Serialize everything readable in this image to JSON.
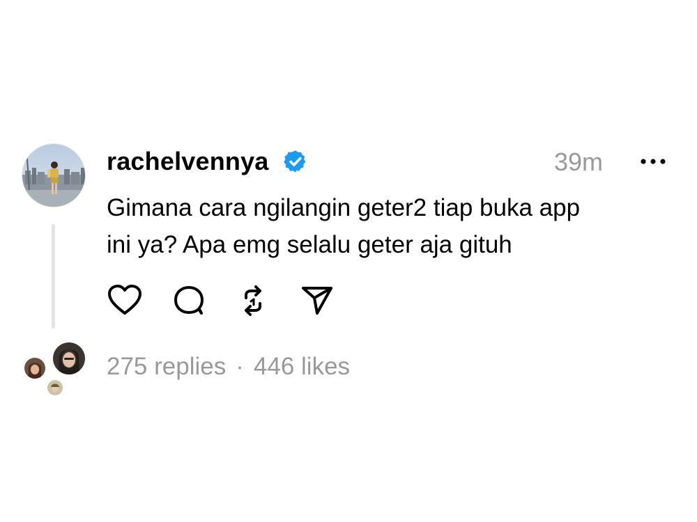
{
  "post": {
    "username": "rachelvennya",
    "verified": true,
    "timestamp": "39m",
    "more_icon": "more-horizontal-icon",
    "text_line1": "Gimana cara ngilangin geter2 tiap buka app",
    "text_line2": "ini ya? Apa emg selalu geter aja gituh",
    "actions": {
      "like_icon": "heart-icon",
      "reply_icon": "comment-bubble-icon",
      "repost_icon": "repost-icon",
      "share_icon": "send-icon"
    },
    "replies": "275 replies",
    "separator": "·",
    "likes": "446 likes"
  },
  "colors": {
    "text": "#000000",
    "muted": "#999999",
    "verified_badge": "#1d9bf0",
    "thread_line": "#e3e3e3",
    "background": "#ffffff"
  }
}
